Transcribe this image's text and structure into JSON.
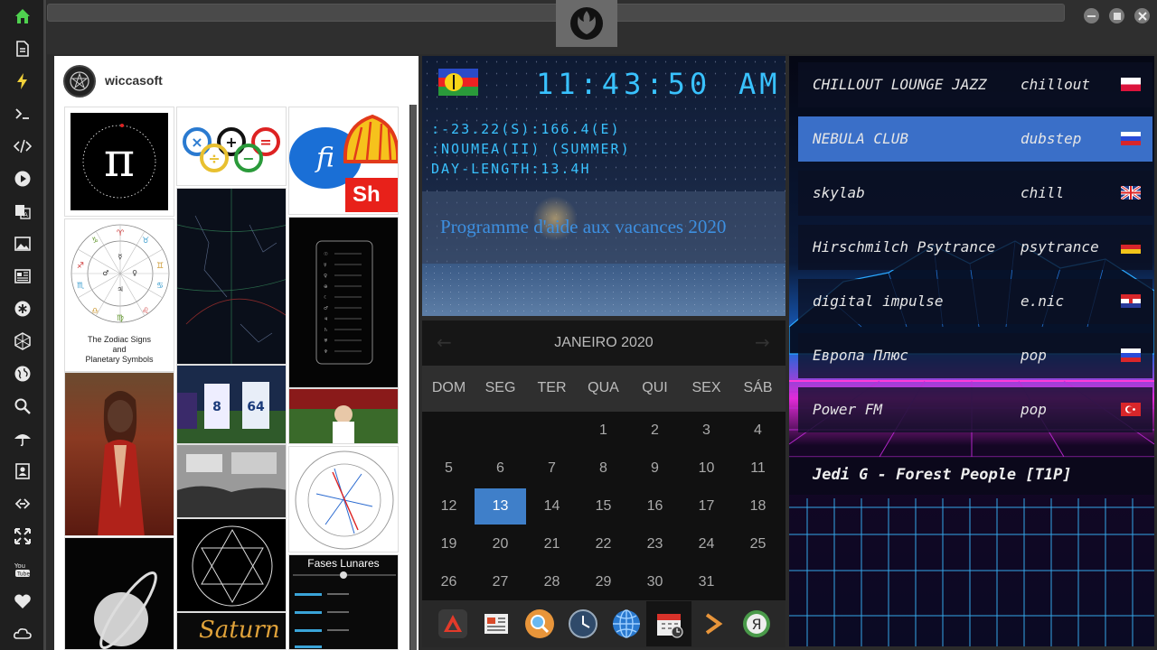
{
  "feed": {
    "username": "wiccasoft",
    "tiles": [
      {
        "caption": "The Zodiac Signs and Planetary Symbols"
      },
      {
        "caption": "Sh"
      },
      {
        "caption": "Fases Lunares"
      },
      {
        "caption": "Saturn"
      }
    ],
    "zodiac_caption_1": "The Zodiac Signs",
    "zodiac_caption_2": "and",
    "zodiac_caption_3": "Planetary Symbols",
    "shell_text": "Sh",
    "fases_title": "Fases Lunares",
    "saturn_text": "Saturn"
  },
  "clock": {
    "time": "11:43:50",
    "ampm": "AM",
    "coords": ":-23.22(S):166.4(E)",
    "city": ":NOUMEA(II) (SUMMER)",
    "day_length": "DAY-LENGTH:13.4H",
    "notice": "Programme d'aide aux vacances 2020"
  },
  "calendar": {
    "title": "JANEIRO 2020",
    "weekdays": [
      "DOM",
      "SEG",
      "TER",
      "QUA",
      "QUI",
      "SEX",
      "SÁB"
    ],
    "weeks": [
      [
        "",
        "",
        "",
        "1",
        "2",
        "3",
        "4"
      ],
      [
        "5",
        "6",
        "7",
        "8",
        "9",
        "10",
        "11"
      ],
      [
        "12",
        "13",
        "14",
        "15",
        "16",
        "17",
        "18"
      ],
      [
        "19",
        "20",
        "21",
        "22",
        "23",
        "24",
        "25"
      ],
      [
        "26",
        "27",
        "28",
        "29",
        "30",
        "31",
        ""
      ]
    ],
    "today": "13"
  },
  "radio": {
    "stations": [
      {
        "name": "CHILLOUT LOUNGE JAZZ",
        "genre": "chillout",
        "flag": "poland"
      },
      {
        "name": "NEBULA CLUB",
        "genre": "dubstep",
        "flag": "russia"
      },
      {
        "name": "skylab",
        "genre": "chill",
        "flag": "uk"
      },
      {
        "name": "Hirschmilch Psytrance",
        "genre": "psytrance",
        "flag": "germany"
      },
      {
        "name": "digital impulse",
        "genre": "e.nic",
        "flag": "croatia"
      },
      {
        "name": "Европа Плюс",
        "genre": "pop",
        "flag": "russia"
      },
      {
        "name": "Power FM",
        "genre": "pop",
        "flag": "turkey"
      }
    ],
    "selected_index": 1,
    "now_playing": "Jedi G - Forest People [T1P]"
  },
  "colors": {
    "accent": "#3f7fc9",
    "digital": "#39c2ff",
    "dock_bg": "#1f1f1f"
  }
}
